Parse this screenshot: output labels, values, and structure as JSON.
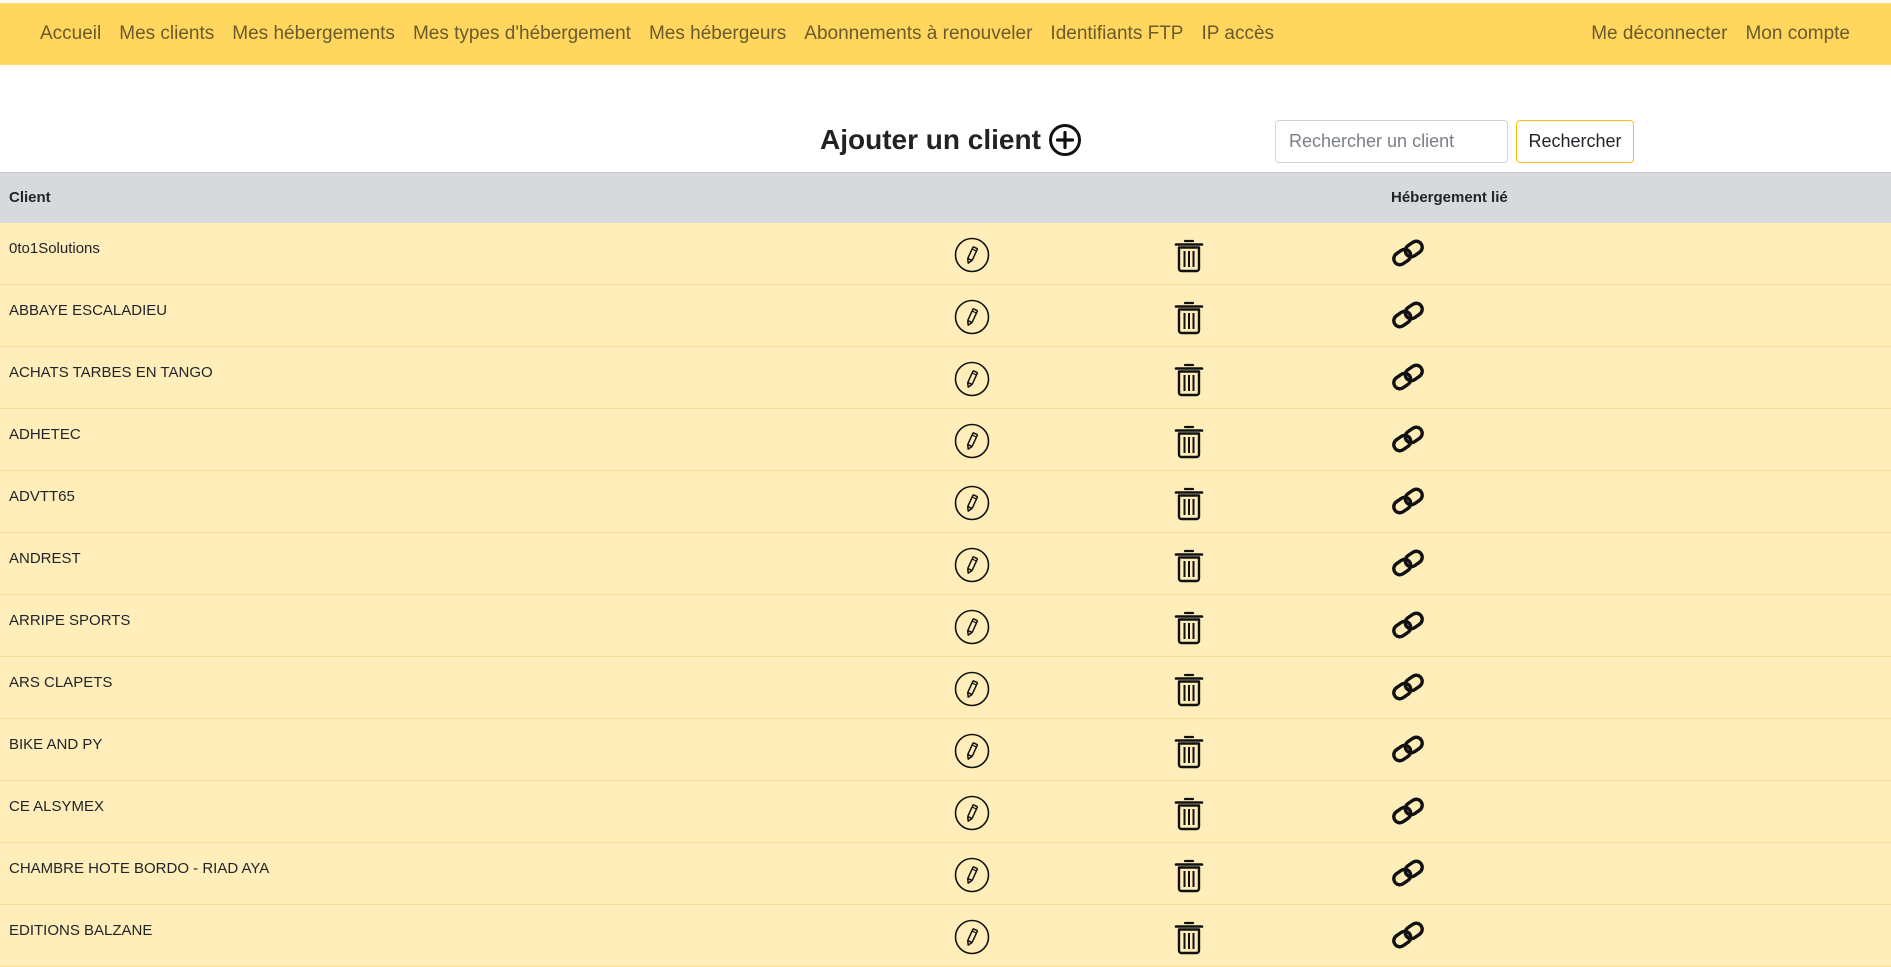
{
  "nav": {
    "left": [
      {
        "id": "accueil",
        "label": "Accueil"
      },
      {
        "id": "mes-clients",
        "label": "Mes clients"
      },
      {
        "id": "mes-hebergements",
        "label": "Mes hébergements"
      },
      {
        "id": "mes-types-hebergement",
        "label": "Mes types d'hébergement"
      },
      {
        "id": "mes-hebergeurs",
        "label": "Mes hébergeurs"
      },
      {
        "id": "abonnements-a-renouveler",
        "label": "Abonnements à renouveler"
      },
      {
        "id": "identifiants-ftp",
        "label": "Identifiants FTP"
      },
      {
        "id": "ip-acces",
        "label": "IP accès"
      }
    ],
    "right": [
      {
        "id": "me-deconnecter",
        "label": "Me déconnecter"
      },
      {
        "id": "mon-compte",
        "label": "Mon compte"
      }
    ]
  },
  "page": {
    "add_client_label": "Ajouter un client",
    "add_icon": "plus-circle-icon"
  },
  "search": {
    "placeholder": "Rechercher un client",
    "value": "",
    "button_label": "Rechercher"
  },
  "table": {
    "headers": {
      "client": "Client",
      "hebergement": "Hébergement lié"
    },
    "row_icons": [
      "pencil-circle-icon",
      "trash-icon",
      "link-icon"
    ],
    "rows": [
      "0to1Solutions",
      "ABBAYE ESCALADIEU",
      "ACHATS TARBES EN TANGO",
      "ADHETEC",
      "ADVTT65",
      "ANDREST",
      "ARRIPE SPORTS",
      "ARS CLAPETS",
      "BIKE AND PY",
      "CE ALSYMEX",
      "CHAMBRE HOTE BORDO - RIAD AYA",
      "EDITIONS BALZANE"
    ]
  },
  "colors": {
    "navbar": "#ffd75e",
    "nav_text": "#6b5b2c",
    "row_bg": "#ffeeba",
    "header_bg": "#d8d9dd",
    "search_button_border": "#ffc107"
  }
}
